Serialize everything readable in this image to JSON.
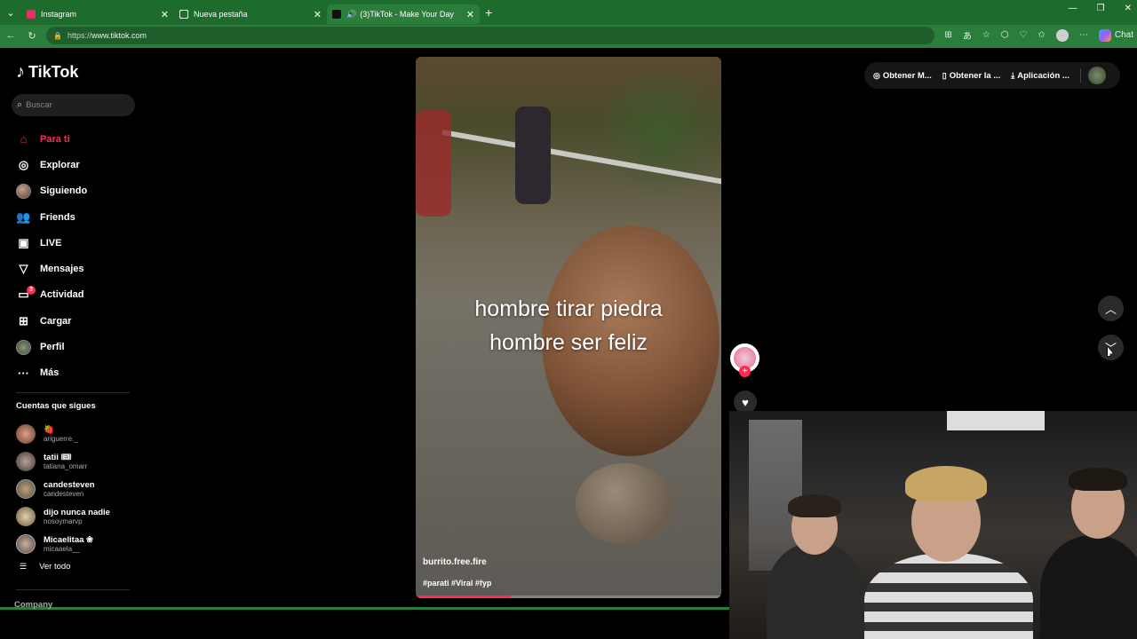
{
  "browser": {
    "tabs": [
      {
        "title": "Instagram",
        "favicon_color": "#e1306c",
        "active": false
      },
      {
        "title": "Nueva pestaña",
        "favicon_color": "#ffffff",
        "active": false
      },
      {
        "title": "(3)TikTok - Make Your Day",
        "favicon_color": "#111111",
        "active": true
      }
    ],
    "url": "https://www.tiktok.com",
    "url_proto": "https://",
    "url_host": "www.tiktok.com",
    "chat_label": "Chat",
    "frame_color": "#2a7d3a"
  },
  "sidebar": {
    "brand": "TikTok",
    "search_placeholder": "Buscar",
    "menu": [
      {
        "label": "Para ti",
        "icon": "home-icon",
        "active": true
      },
      {
        "label": "Explorar",
        "icon": "compass-icon"
      },
      {
        "label": "Siguiendo",
        "icon": "following-avatar"
      },
      {
        "label": "Friends",
        "icon": "friends-icon"
      },
      {
        "label": "LIVE",
        "icon": "live-icon"
      },
      {
        "label": "Mensajes",
        "icon": "send-icon"
      },
      {
        "label": "Actividad",
        "icon": "inbox-icon",
        "badge": "3"
      },
      {
        "label": "Cargar",
        "icon": "upload-icon"
      },
      {
        "label": "Perfil",
        "icon": "profile-avatar"
      },
      {
        "label": "Más",
        "icon": "more-icon"
      }
    ],
    "following_title": "Cuentas que sigues",
    "following": [
      {
        "name": "🍓",
        "handle": "ariguerre._"
      },
      {
        "name": "tatii 🎟",
        "handle": "tatiana_omarr"
      },
      {
        "name": "candesteven",
        "handle": "candesteven"
      },
      {
        "name": "dijo nunca nadie",
        "handle": "nosoymarvp"
      },
      {
        "name": "Micaelitaa ❀",
        "handle": "micaaela__"
      }
    ],
    "see_all": "Ver todo",
    "company": "Company"
  },
  "video": {
    "caption_line1": "hombre tirar piedra",
    "caption_line2": "hombre ser feliz",
    "author": "burrito.free.fire",
    "hashtags": "#parati #Viral #fyp",
    "progress": 0.31
  },
  "top_actions": {
    "get_coins": "Obtener M...",
    "get_app": "Obtener la ...",
    "download": "Aplicación ..."
  },
  "colors": {
    "accent": "#fe2c55",
    "bg": "#000000"
  }
}
